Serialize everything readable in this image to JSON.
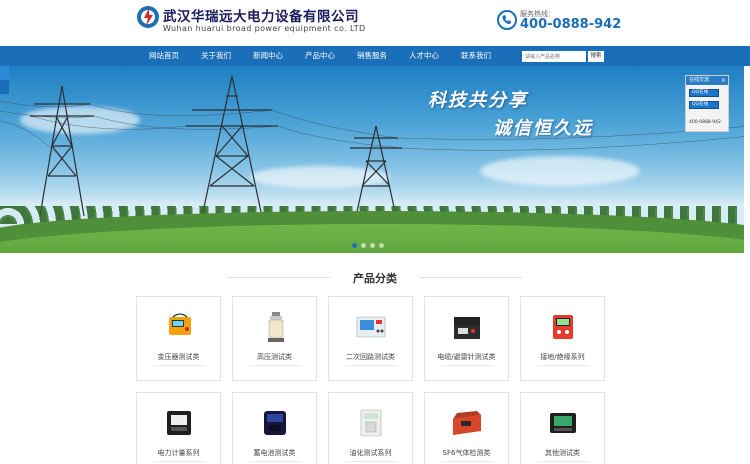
{
  "header": {
    "brand_cn": "武汉华瑞远大电力设备有限公司",
    "brand_en": "Wuhan huarui broad power equipment co. LTD",
    "hotline_label": "服务热线：",
    "hotline_number": "400-0888-942",
    "hotline_icon": "phone-icon"
  },
  "nav": {
    "items": [
      "网站首页",
      "关于我们",
      "新闻中心",
      "产品中心",
      "销售服务",
      "人才中心",
      "联系我们"
    ],
    "search_placeholder": "请输入产品名称",
    "search_button": "搜索"
  },
  "banner": {
    "slogan_1": "科技共分享",
    "slogan_2": "诚信恒久远",
    "slides": 4,
    "active_slide": 1
  },
  "service": {
    "title": "在线交流",
    "close": "×",
    "qq_buttons": [
      "QQ在线",
      "QQ在线"
    ],
    "phone": "400-0888-942"
  },
  "section": {
    "title": "产品分类"
  },
  "products": [
    {
      "label": "变压器测试类",
      "icon": "transformer-tester-icon"
    },
    {
      "label": "高压测试类",
      "icon": "high-voltage-tester-icon"
    },
    {
      "label": "二次回路测试类",
      "icon": "secondary-circuit-tester-icon"
    },
    {
      "label": "电缆/避雷针测试类",
      "icon": "cable-tester-icon"
    },
    {
      "label": "接地/绝缘系列",
      "icon": "grounding-tester-icon"
    },
    {
      "label": "电力计量系列",
      "icon": "power-meter-icon"
    },
    {
      "label": "蓄电池测试类",
      "icon": "battery-tester-icon"
    },
    {
      "label": "油化测试系列",
      "icon": "oil-tester-icon"
    },
    {
      "label": "SF6气体检测类",
      "icon": "sf6-detector-icon"
    },
    {
      "label": "其他测试类",
      "icon": "other-tester-icon"
    }
  ],
  "colors": {
    "brand_blue": "#1b6fb8",
    "dark_navy": "#1a1a5e"
  }
}
